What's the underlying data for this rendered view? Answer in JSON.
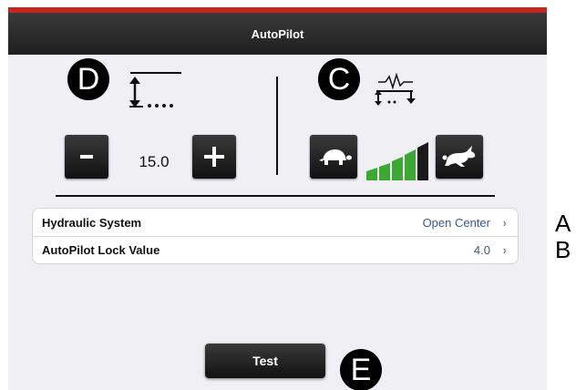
{
  "window": {
    "title": "AutoPilot"
  },
  "callouts": {
    "d": "D",
    "c": "C",
    "e": "E"
  },
  "side_labels": {
    "a": "A",
    "b": "B"
  },
  "stepper": {
    "value": "15.0"
  },
  "speed_meter": {
    "active_bars": 4,
    "total_bars": 5,
    "active_color": "#3aa832",
    "inactive_color": "#1a1a1a"
  },
  "settings": [
    {
      "label": "Hydraulic System",
      "value": "Open Center"
    },
    {
      "label": "AutoPilot Lock Value",
      "value": "4.0"
    }
  ],
  "actions": {
    "test_label": "Test"
  },
  "icons": {
    "height": "height-adjust-icon",
    "response": "response-graph-icon",
    "slow": "turtle-icon",
    "fast": "rabbit-icon",
    "chevron": "chevron-right-icon"
  },
  "colors": {
    "accent_strip": "#c8251f",
    "titlebar": "#262626",
    "link_value": "#3a5a8c"
  }
}
